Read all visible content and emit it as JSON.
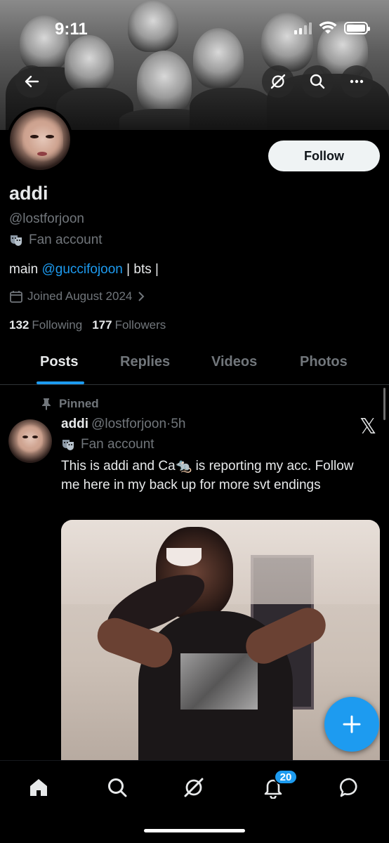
{
  "status": {
    "time": "9:11"
  },
  "profile": {
    "name": "addi",
    "handle": "@lostforjoon",
    "category": "Fan account",
    "bio_prefix": "main ",
    "bio_mention": "@guccifojoon",
    "bio_suffix": " | bts |",
    "joined": "Joined August 2024",
    "following_count": "132",
    "following_label": "Following",
    "followers_count": "177",
    "followers_label": "Followers",
    "follow_label": "Follow"
  },
  "tabs": [
    {
      "label": "Posts",
      "active": true
    },
    {
      "label": "Replies",
      "active": false
    },
    {
      "label": "Videos",
      "active": false
    },
    {
      "label": "Photos",
      "active": false
    }
  ],
  "post": {
    "pinned_label": "Pinned",
    "author_name": "addi",
    "author_handle": "@lostforjoon",
    "separator": "·",
    "time": "5h",
    "category": "Fan account",
    "text": "This is addi and Ca🐀 is reporting my acc. Follow me here in my back up for more svt endings"
  },
  "nav": {
    "notifications_badge": "20"
  },
  "colors": {
    "accent": "#1d9bf0",
    "background": "#000000",
    "text_primary": "#e7e9ea",
    "text_secondary": "#71767b"
  },
  "icons": {
    "header": [
      "back-arrow-icon",
      "grok-icon",
      "search-icon",
      "more-icon"
    ],
    "bottom_nav": [
      "home-icon",
      "search-icon",
      "grok-icon",
      "notifications-icon",
      "messages-icon"
    ]
  }
}
